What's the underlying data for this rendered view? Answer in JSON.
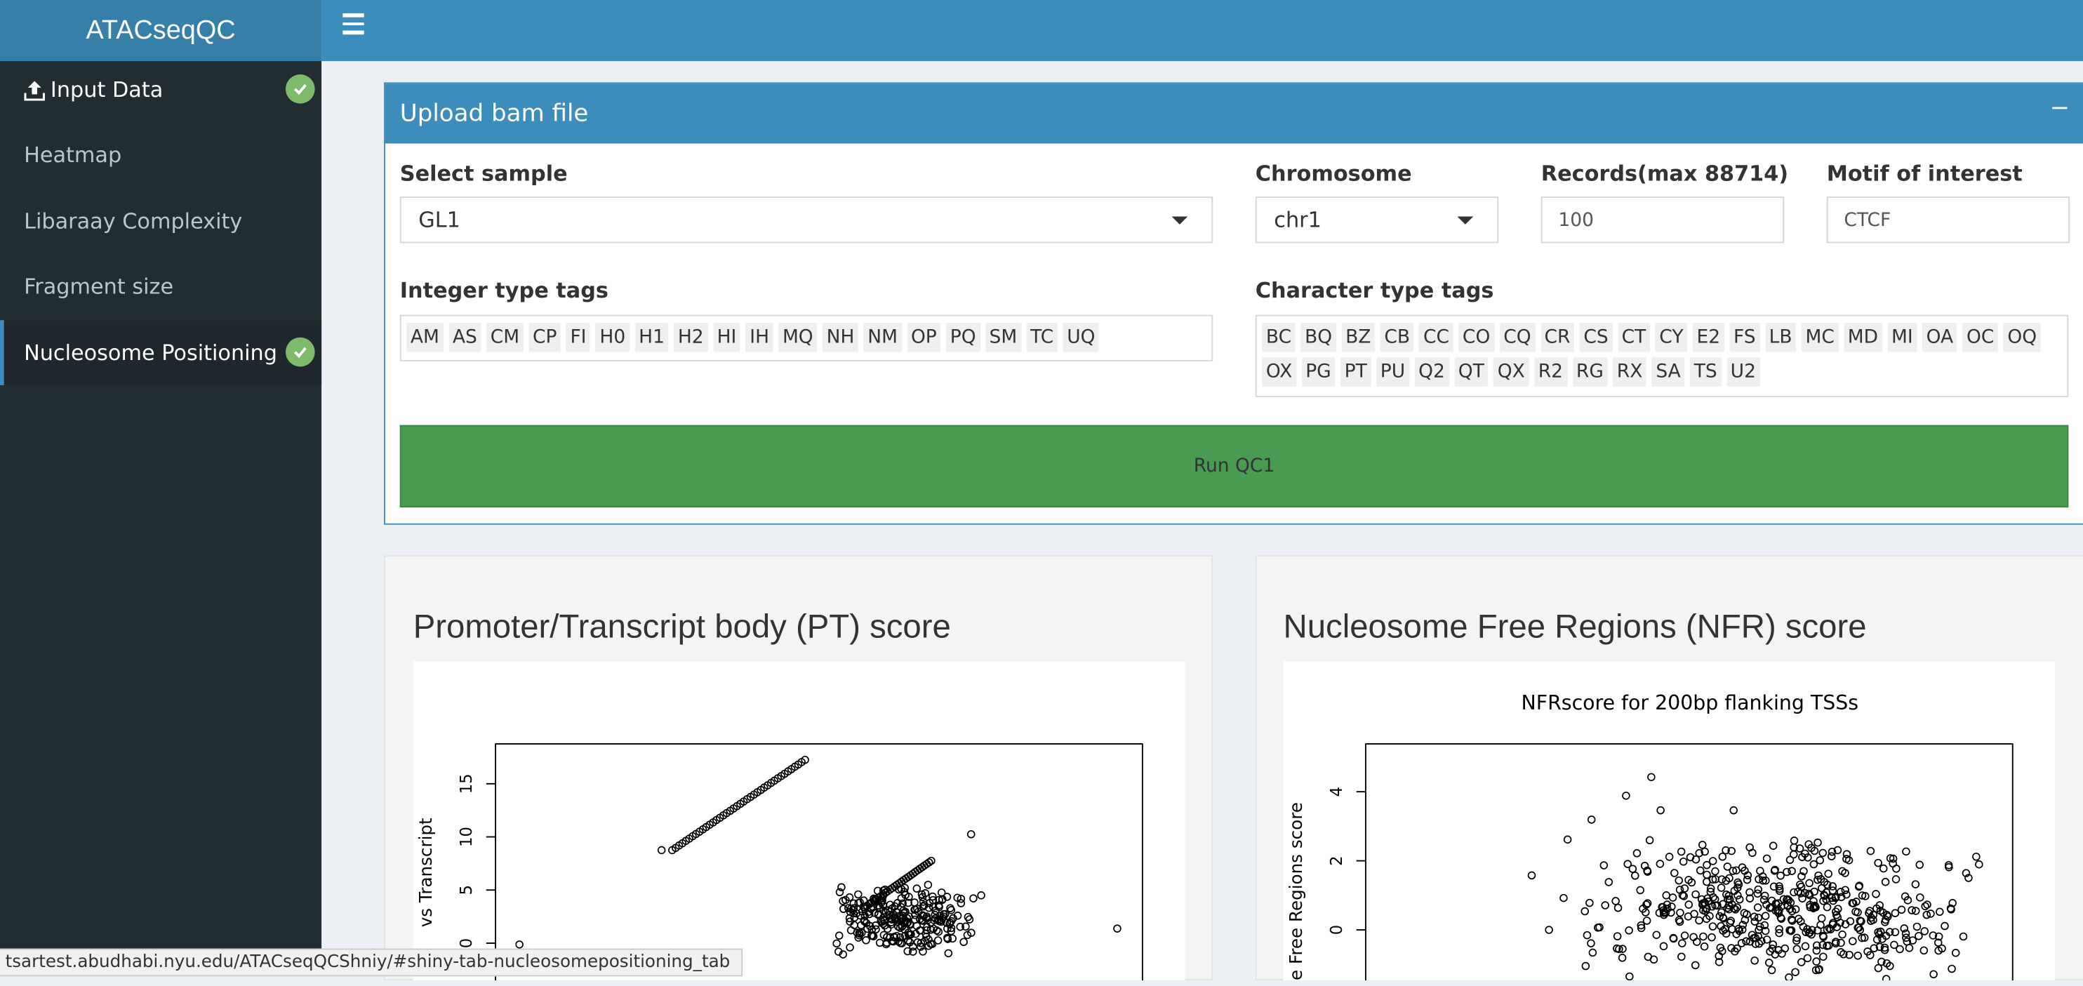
{
  "app": {
    "title": "ATACseqQC"
  },
  "sidebar": {
    "items": [
      {
        "label": "Input Data",
        "checked": true
      },
      {
        "label": "Heatmap",
        "checked": false
      },
      {
        "label": "Libaraay Complexity",
        "checked": false
      },
      {
        "label": "Fragment size",
        "checked": false
      },
      {
        "label": "Nucleosome Positioning",
        "checked": true
      }
    ]
  },
  "upload_box": {
    "title": "Upload bam file",
    "collapse_symbol": "−",
    "select_sample": {
      "label": "Select sample",
      "value": "GL1"
    },
    "chromosome": {
      "label": "Chromosome",
      "value": "chr1"
    },
    "records": {
      "label": "Records(max 88714)",
      "value": "100"
    },
    "motif": {
      "label": "Motif of interest",
      "value": "CTCF"
    },
    "integer_tags": {
      "label": "Integer type tags",
      "tags": [
        "AM",
        "AS",
        "CM",
        "CP",
        "FI",
        "H0",
        "H1",
        "H2",
        "HI",
        "IH",
        "MQ",
        "NH",
        "NM",
        "OP",
        "PQ",
        "SM",
        "TC",
        "UQ"
      ]
    },
    "character_tags": {
      "label": "Character type tags",
      "tags": [
        "BC",
        "BQ",
        "BZ",
        "CB",
        "CC",
        "CO",
        "CQ",
        "CR",
        "CS",
        "CT",
        "CY",
        "E2",
        "FS",
        "LB",
        "MC",
        "MD",
        "MI",
        "OA",
        "OC",
        "OQ",
        "OX",
        "PG",
        "PT",
        "PU",
        "Q2",
        "QT",
        "QX",
        "R2",
        "RG",
        "RX",
        "SA",
        "TS",
        "U2"
      ]
    },
    "run_button": "Run QC1"
  },
  "pt_panel": {
    "title": "Promoter/Transcript body (PT) score",
    "chart_data": {
      "type": "scatter",
      "title": "",
      "ylabel": "vs Transcript",
      "yticks": [
        "0",
        "5",
        "10",
        "15"
      ]
    }
  },
  "nfr_panel": {
    "title": "Nucleosome Free Regions (NFR) score",
    "chart_data": {
      "type": "scatter",
      "title": "NFRscore for 200bp flanking TSSs",
      "ylabel": "e Free Regions score",
      "yticks": [
        "0",
        "2",
        "4"
      ]
    }
  },
  "status_bar": {
    "url": "tsartest.abudhabi.nyu.edu/ATACseqQCShniy/#shiny-tab-nucleosomepositioning_tab"
  },
  "colors": {
    "header": "#3c8dbc",
    "sidebar": "#222d32",
    "run_button": "#4a9a52",
    "check": "#7dbb6b"
  }
}
